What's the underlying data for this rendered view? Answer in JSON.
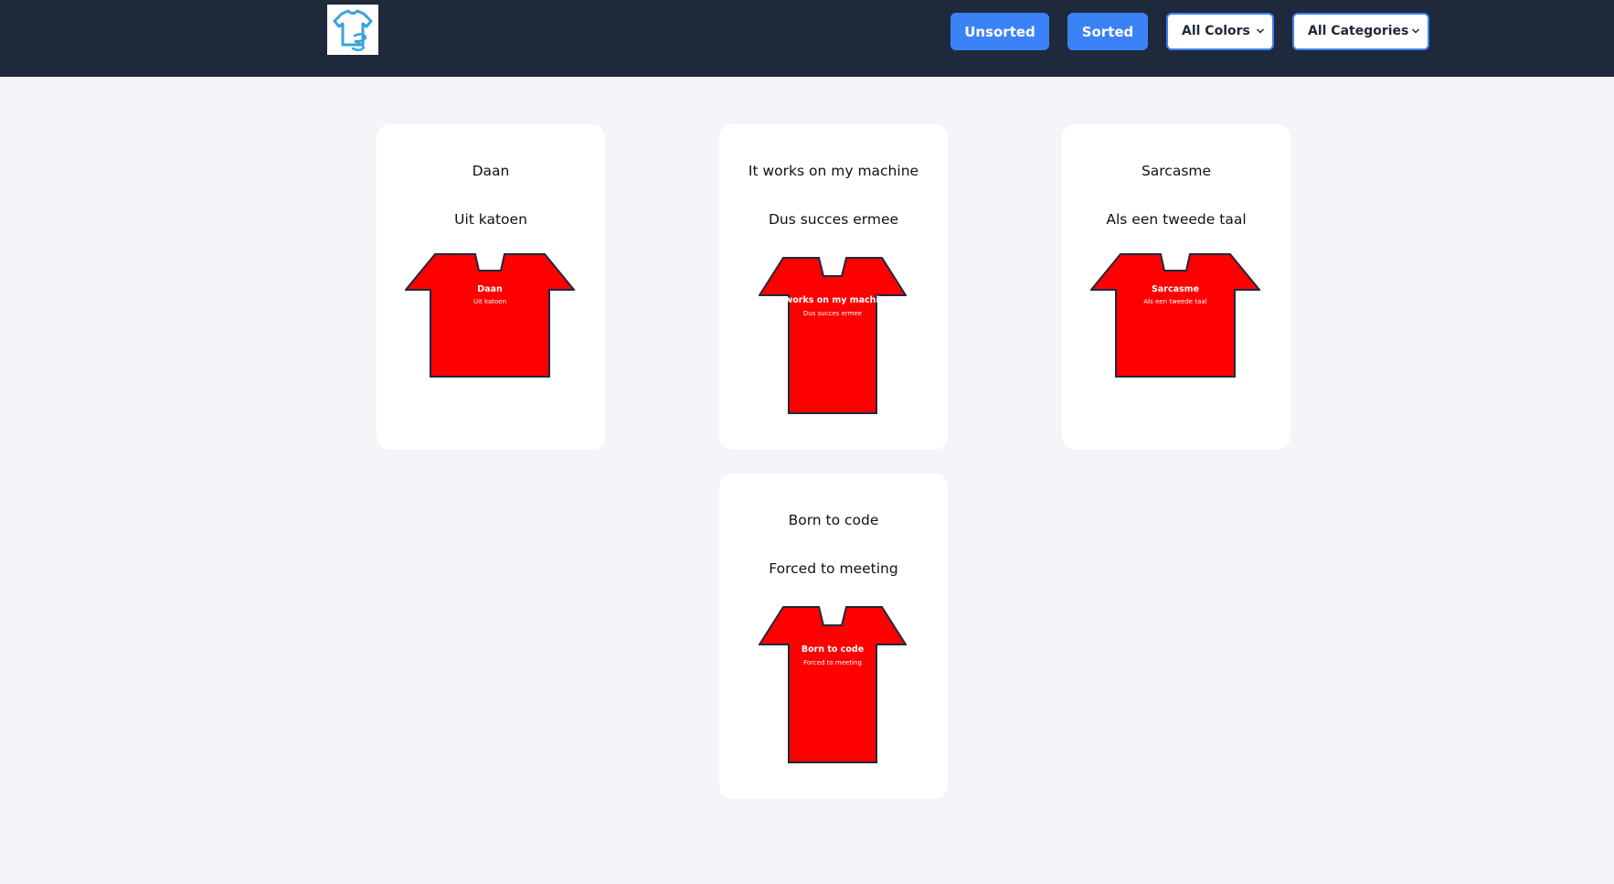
{
  "header": {
    "logo_icon": "tshirt-icon",
    "buttons": {
      "unsorted_label": "Unsorted",
      "sorted_label": "Sorted"
    },
    "filters": {
      "colors_selected": "All Colors",
      "categories_selected": "All Categories"
    }
  },
  "colors": {
    "header_bg": "#1e293b",
    "accent": "#3b82f6",
    "page_bg": "#f3f5f9",
    "shirt_fill": "#ff0000",
    "shirt_outline": "#1e293b"
  },
  "cards": [
    {
      "title": "Daan",
      "subtitle": "Uit katoen",
      "shirt_title": "Daan",
      "shirt_subtitle": "Uit katoen"
    },
    {
      "title": "It works on my machine",
      "subtitle": "Dus succes ermee",
      "shirt_title": "It works on my machine",
      "shirt_subtitle": "Dus succes ermee"
    },
    {
      "title": "Sarcasme",
      "subtitle": "Als een tweede taal",
      "shirt_title": "Sarcasme",
      "shirt_subtitle": "Als een tweede taal"
    },
    {
      "title": "Born to code",
      "subtitle": "Forced to meeting",
      "shirt_title": "Born to code",
      "shirt_subtitle": "Forced to meeting"
    }
  ]
}
